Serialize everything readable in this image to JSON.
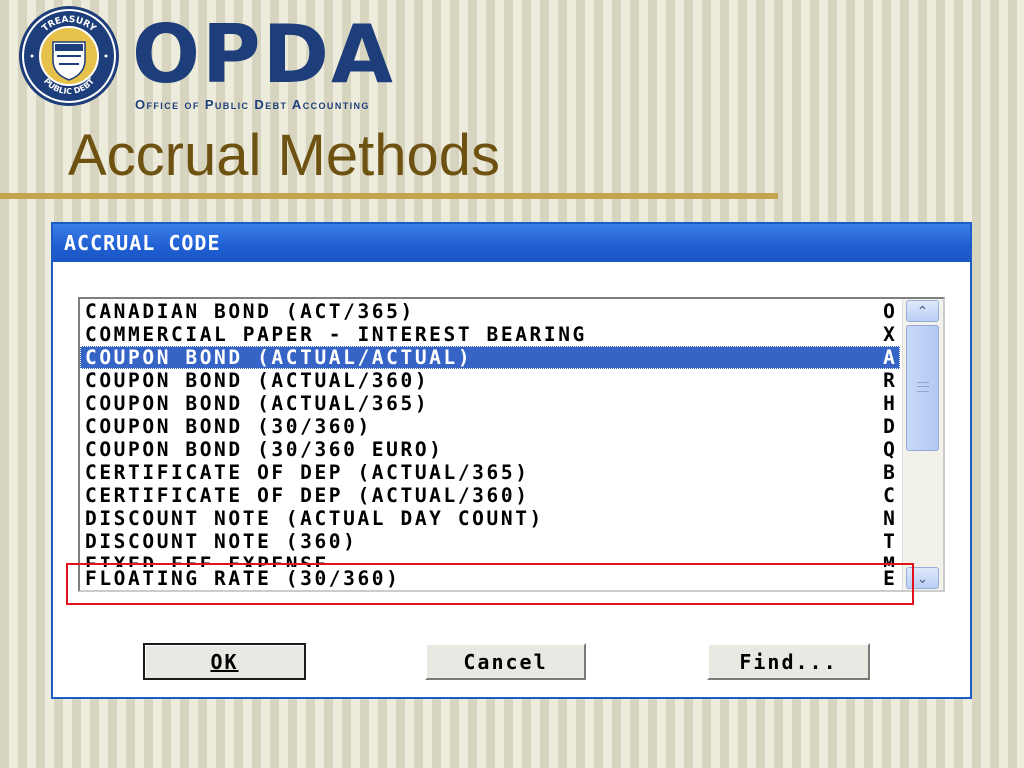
{
  "header": {
    "logo_text": "OPDA",
    "logo_subtitle": "Office of Public Debt Accounting",
    "seal_text_top": "TREASURY",
    "seal_text_bottom": "PUBLIC DEBT"
  },
  "slide": {
    "title": "Accrual Methods"
  },
  "dialog": {
    "title": "ACCRUAL CODE",
    "items": [
      {
        "description": "CANADIAN BOND (ACT/365)",
        "code": "O"
      },
      {
        "description": "COMMERCIAL PAPER - INTEREST BEARING",
        "code": "X"
      },
      {
        "description": "COUPON BOND (ACTUAL/ACTUAL)",
        "code": "A"
      },
      {
        "description": "COUPON BOND (ACTUAL/360)",
        "code": "R"
      },
      {
        "description": "COUPON BOND (ACTUAL/365)",
        "code": "H"
      },
      {
        "description": "COUPON BOND (30/360)",
        "code": "D"
      },
      {
        "description": "COUPON BOND (30/360 EURO)",
        "code": "Q"
      },
      {
        "description": "CERTIFICATE OF DEP (ACTUAL/365)",
        "code": "B"
      },
      {
        "description": "CERTIFICATE OF DEP (ACTUAL/360)",
        "code": "C"
      },
      {
        "description": "DISCOUNT NOTE (ACTUAL DAY COUNT)",
        "code": "N"
      },
      {
        "description": "DISCOUNT NOTE (360)",
        "code": "T"
      },
      {
        "description": "FIXED FEE EXPENSE",
        "code": "M"
      },
      {
        "description": "FLOATING RATE (30/360)",
        "code": "E"
      }
    ],
    "selected_index": 2,
    "highlighted_index": 12,
    "buttons": {
      "ok_label": "OK",
      "cancel_label": "Cancel",
      "find_label": "Find..."
    }
  },
  "colors": {
    "title_bar": "#1f5fd3",
    "selection": "#3563c6",
    "highlight_box": "#e0141c",
    "slide_title": "#6e5212",
    "logo": "#1d3e7a"
  }
}
